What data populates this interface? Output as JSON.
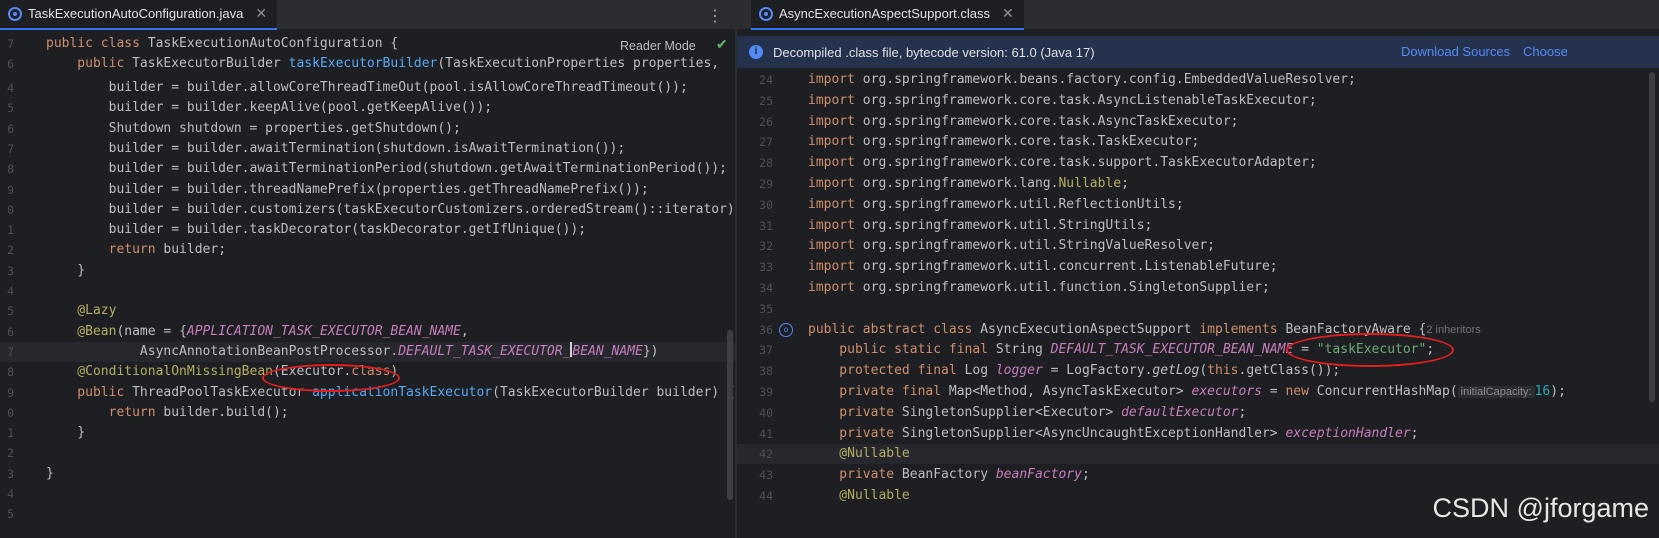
{
  "left": {
    "tab_title": "TaskExecutionAutoConfiguration.java",
    "tab_close": "✕",
    "menu_glyph": "⋮",
    "reader_mode": "Reader Mode",
    "check_glyph": "✔",
    "line_numbers": [
      "7",
      "6",
      "4",
      "5",
      "6",
      "7",
      "8",
      "9",
      "0",
      "1",
      "2",
      "3",
      "4",
      "5",
      "6",
      "7",
      "8",
      "9",
      "0",
      "1",
      "2",
      "3",
      "4",
      "5"
    ],
    "code": {
      "l0_kw": "public class ",
      "l0_rest": "TaskExecutionAutoConfiguration {",
      "l1_kw": "    public ",
      "l1_type": "TaskExecutorBuilder ",
      "l1_fn": "taskExecutorBuilder",
      "l1_rest": "(TaskExecutionProperties properties,",
      "l2": "        builder = builder.allowCoreThreadTimeOut(pool.isAllowCoreThreadTimeout());",
      "l3": "        builder = builder.keepAlive(pool.getKeepAlive());",
      "l4": "        Shutdown shutdown = properties.getShutdown();",
      "l5": "        builder = builder.awaitTermination(shutdown.isAwaitTermination());",
      "l6": "        builder = builder.awaitTerminationPeriod(shutdown.getAwaitTerminationPeriod());",
      "l7": "        builder = builder.threadNamePrefix(properties.getThreadNamePrefix());",
      "l8": "        builder = builder.customizers(taskExecutorCustomizers.orderedStream()::iterator);",
      "l9": "        builder = builder.taskDecorator(taskDecorator.getIfUnique());",
      "l10_kw": "        return ",
      "l10_rest": "builder;",
      "l11": "    }",
      "l13": "    @Lazy",
      "l14_an": "    @Bean",
      "l14_mid": "(name = {",
      "l14_cst": "APPLICATION_TASK_EXECUTOR_BEAN_NAME",
      "l14_end": ",",
      "l15_a": "            AsyncAnnotationBeanPostProcessor.",
      "l15_cst_a": "DEFAULT_TASK_EXECUTOR_",
      "l15_cst_b": "BEAN_NAME",
      "l15_end": "})",
      "l16_an": "    @ConditionalOnMissingBean",
      "l16_mid": "(Executor.",
      "l16_kw": "class",
      "l16_end": ")",
      "l17_kw": "    public ",
      "l17_type": "ThreadPoolTaskExecutor ",
      "l17_fn": "applicationTaskExecutor",
      "l17_rest": "(TaskExecutorBuilder builder) {",
      "l18_kw": "        return ",
      "l18_rest": "builder.build();",
      "l19": "    }",
      "l21": "}"
    }
  },
  "right": {
    "tab_title": "AsyncExecutionAspectSupport.class",
    "tab_close": "✕",
    "banner_text": "Decompiled .class file, bytecode version: 61.0 (Java 17)",
    "download_sources": "Download Sources",
    "choose_sources": "Choose",
    "line_numbers": [
      "24",
      "25",
      "26",
      "27",
      "28",
      "29",
      "30",
      "31",
      "32",
      "33",
      "34",
      "35",
      "36",
      "37",
      "38",
      "39",
      "40",
      "41",
      "42",
      "43",
      "44"
    ],
    "code": {
      "i0": "org.springframework.beans.factory.config.EmbeddedValueResolver;",
      "i1": "org.springframework.core.task.AsyncListenableTaskExecutor;",
      "i2": "org.springframework.core.task.AsyncTaskExecutor;",
      "i3": "org.springframework.core.task.TaskExecutor;",
      "i4": "org.springframework.core.task.support.TaskExecutorAdapter;",
      "i5a": "org.springframework.lang.",
      "i5b": "Nullable",
      "i5c": ";",
      "i6": "org.springframework.util.ReflectionUtils;",
      "i7": "org.springframework.util.StringUtils;",
      "i8": "org.springframework.util.StringValueResolver;",
      "i9": "org.springframework.util.concurrent.ListenableFuture;",
      "i10": "org.springframework.util.function.SingletonSupplier;",
      "import_kw": "import ",
      "c12_kw": "public abstract class ",
      "c12_name": "AsyncExecutionAspectSupport ",
      "c12_kw2": "implements ",
      "c12_rest": "BeanFactoryAware {",
      "c12_hint": "2 inheritors",
      "c13_kw": "    public static final ",
      "c13_type": "String ",
      "c13_cst": "DEFAULT_TASK_EXECUTOR_BEAN_NAME",
      "c13_eq": " = ",
      "c13_str": "\"taskExecutor\"",
      "c13_end": ";",
      "c14_kw": "    protected final ",
      "c14_type": "Log ",
      "c14_name": "logger",
      "c14_eq": " = LogFactory.",
      "c14_fn": "getLog",
      "c14_p": "(",
      "c14_kw2": "this",
      "c14_end": ".getClass());",
      "c15_kw": "    private final ",
      "c15_type": "Map<Method, AsyncTaskExecutor> ",
      "c15_name": "executors",
      "c15_eq": " = ",
      "c15_kw2": "new ",
      "c15_rest": "ConcurrentHashMap(",
      "c15_hint": "initialCapacity:",
      "c15_num": "16",
      "c15_end": ");",
      "c16_kw": "    private ",
      "c16_type": "SingletonSupplier<Executor> ",
      "c16_name": "defaultExecutor",
      "c16_end": ";",
      "c17_kw": "    private ",
      "c17_type": "SingletonSupplier<AsyncUncaughtExceptionHandler> ",
      "c17_name": "exceptionHandler",
      "c17_end": ";",
      "c18": "    @Nullable",
      "c19_kw": "    private ",
      "c19_type": "BeanFactory ",
      "c19_name": "beanFactory",
      "c19_end": ";",
      "c20": "    @Nullable"
    }
  },
  "watermark": "CSDN @jforgame"
}
